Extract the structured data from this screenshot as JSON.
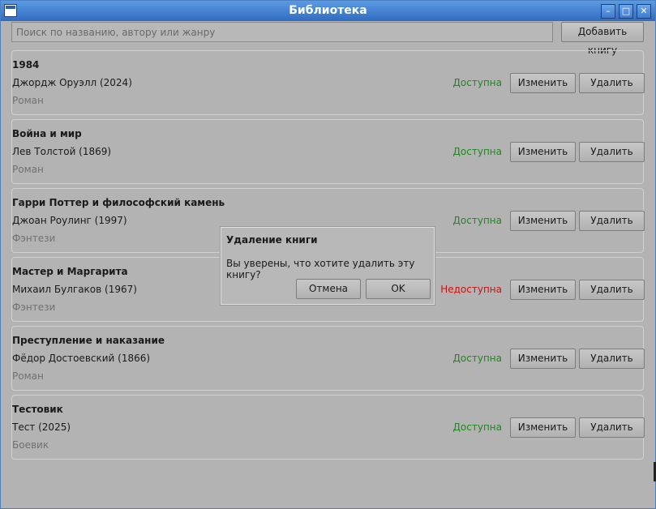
{
  "window": {
    "title": "Библиотека",
    "buttons": {
      "minimize": "–",
      "maximize": "□",
      "close": "✕"
    }
  },
  "toolbar": {
    "search_placeholder": "Поиск по названию, автору или жанру",
    "add_label": "Добавить книгу"
  },
  "books": [
    {
      "title": "1984",
      "author": "Джордж Оруэлл (2024)",
      "genre": "Роман",
      "status": "Доступна",
      "available": true
    },
    {
      "title": "Война и мир",
      "author": "Лев Толстой (1869)",
      "genre": "Роман",
      "status": "Доступна",
      "available": true
    },
    {
      "title": "Гарри Поттер и философский камень",
      "author": "Джоан Роулинг (1997)",
      "genre": "Фэнтези",
      "status": "Доступна",
      "available": true
    },
    {
      "title": "Мастер и Маргарита",
      "author": "Михаил Булгаков (1967)",
      "genre": "Фэнтези",
      "status": "Недоступна",
      "available": false
    },
    {
      "title": "Преступление и наказание",
      "author": "Фёдор Достоевский (1866)",
      "genre": "Роман",
      "status": "Доступна",
      "available": true
    },
    {
      "title": "Тестовик",
      "author": "Тест (2025)",
      "genre": "Боевик",
      "status": "Доступна",
      "available": true
    }
  ],
  "actions": {
    "edit_label": "Изменить",
    "delete_label": "Удалить"
  },
  "dialog": {
    "title": "Удаление книги",
    "message": "Вы уверены, что хотите удалить эту книгу?",
    "cancel_label": "Отмена",
    "ok_label": "OK"
  },
  "colors": {
    "available": "#1c8a1c",
    "unavailable": "#d01010",
    "titlebar": "#2f6cc0"
  }
}
